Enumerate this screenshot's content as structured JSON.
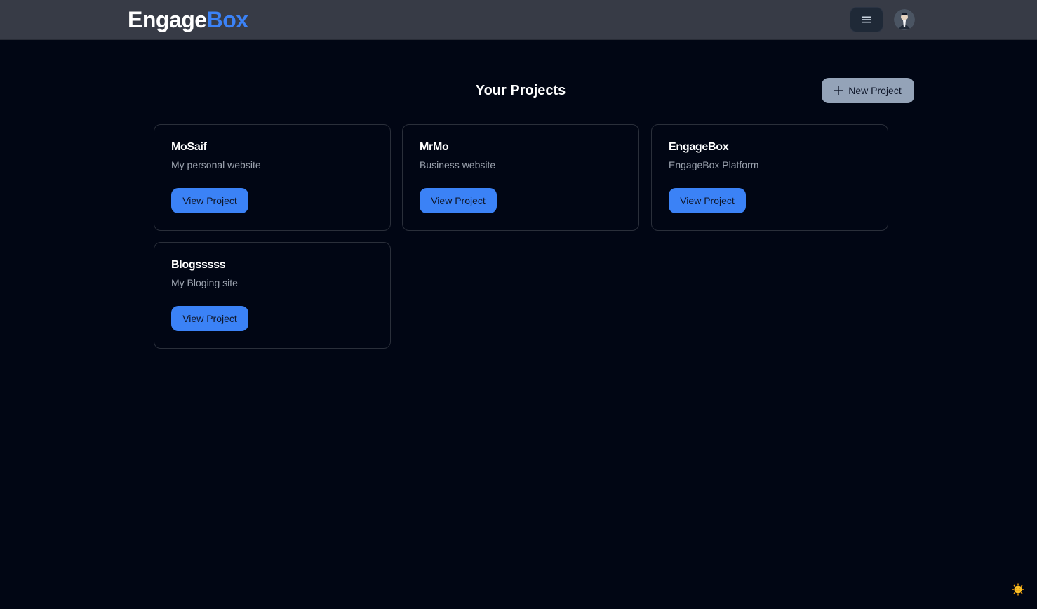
{
  "header": {
    "logo_part1": "Engage",
    "logo_part2": "Box",
    "menu_icon": "hamburger-menu-icon",
    "avatar_icon": "user-avatar"
  },
  "main": {
    "title": "Your Projects",
    "new_project_label": "New Project",
    "new_project_icon": "plus-icon",
    "projects": [
      {
        "name": "MoSaif",
        "description": "My personal website",
        "button": "View Project"
      },
      {
        "name": "MrMo",
        "description": "Business website",
        "button": "View Project"
      },
      {
        "name": "EngageBox",
        "description": "EngageBox Platform",
        "button": "View Project"
      },
      {
        "name": "Blogsssss",
        "description": "My Bloging site",
        "button": "View Project"
      }
    ]
  },
  "colors": {
    "background": "#010614",
    "topbar": "#373b46",
    "accent": "#3b82f6",
    "new_project_bg": "#94a3b8",
    "muted_text": "#9ca3af"
  },
  "corner_icon": "sun-face-icon"
}
